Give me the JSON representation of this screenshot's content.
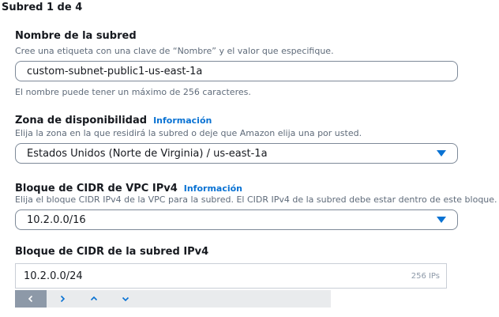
{
  "section": {
    "title": "Subred 1 de 4"
  },
  "name_field": {
    "label": "Nombre de la subred",
    "description": "Cree una etiqueta con una clave de “Nombre” y el valor que especifique.",
    "value": "custom-subnet-public1-us-east-1a",
    "hint": "El nombre puede tener un máximo de 256 caracteres."
  },
  "az_field": {
    "label": "Zona de disponibilidad",
    "info": "Información",
    "description": "Elija la zona en la que residirá la subred o deje que Amazon elija una por usted.",
    "selected": "Estados Unidos (Norte de Virginia) / us-east-1a"
  },
  "vpc_cidr_field": {
    "label": "Bloque de CIDR de VPC IPv4",
    "info": "Información",
    "description": "Elija el bloque CIDR IPv4 de la VPC para la subred. El CIDR IPv4 de la subred debe estar dentro de este bloque.",
    "selected": "10.2.0.0/16"
  },
  "subnet_cidr_field": {
    "label": "Bloque de CIDR de la subred IPv4",
    "value": "10.2.0.0/24",
    "suffix": "256 IPs"
  },
  "stepper": {
    "buttons": [
      "chevron-left-icon",
      "chevron-right-icon",
      "chevron-up-icon",
      "chevron-down-icon"
    ]
  },
  "colors": {
    "link": "#0972d3",
    "border": "#7d8998",
    "muted": "#5f6b7a",
    "stepper_bg": "#e9ebed",
    "stepper_active": "#8d99a8"
  }
}
